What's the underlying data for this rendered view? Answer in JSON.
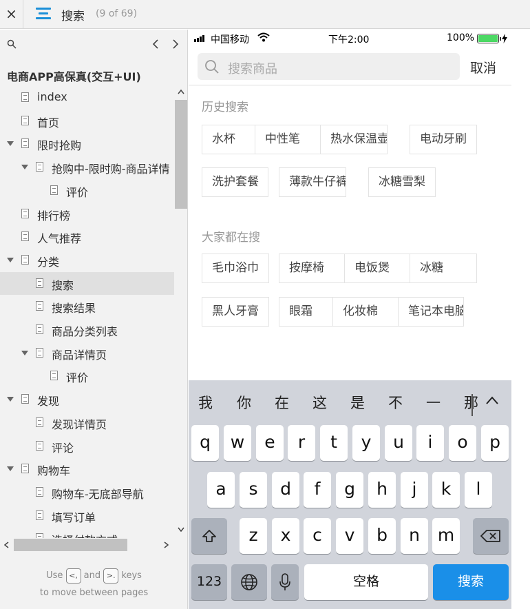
{
  "topbar": {
    "close_glyph": "×",
    "title": "搜索",
    "count": "(9 of 69)",
    "menu_icon": "hamburger-menu-icon"
  },
  "sidebar": {
    "project_title": "电商APP高保真(交互+UI)",
    "tree": [
      {
        "label": "index",
        "level": 0,
        "expandable": false,
        "selected": false
      },
      {
        "label": "首页",
        "level": 0,
        "expandable": false,
        "selected": false
      },
      {
        "label": "限时抢购",
        "level": 0,
        "expandable": true,
        "selected": false
      },
      {
        "label": "抢购中-限时购-商品详情",
        "level": 1,
        "expandable": true,
        "selected": false
      },
      {
        "label": "评价",
        "level": 2,
        "expandable": false,
        "selected": false
      },
      {
        "label": "排行榜",
        "level": 0,
        "expandable": false,
        "selected": false
      },
      {
        "label": "人气推荐",
        "level": 0,
        "expandable": false,
        "selected": false
      },
      {
        "label": "分类",
        "level": 0,
        "expandable": true,
        "selected": false
      },
      {
        "label": "搜索",
        "level": 1,
        "expandable": false,
        "selected": true
      },
      {
        "label": "搜索结果",
        "level": 1,
        "expandable": false,
        "selected": false
      },
      {
        "label": "商品分类列表",
        "level": 1,
        "expandable": false,
        "selected": false
      },
      {
        "label": "商品详情页",
        "level": 1,
        "expandable": true,
        "selected": false
      },
      {
        "label": "评价",
        "level": 2,
        "expandable": false,
        "selected": false
      },
      {
        "label": "发现",
        "level": 0,
        "expandable": true,
        "selected": false
      },
      {
        "label": "发现详情页",
        "level": 1,
        "expandable": false,
        "selected": false
      },
      {
        "label": "评论",
        "level": 1,
        "expandable": false,
        "selected": false
      },
      {
        "label": "购物车",
        "level": 0,
        "expandable": true,
        "selected": false
      },
      {
        "label": "购物车-无底部导航",
        "level": 1,
        "expandable": false,
        "selected": false
      },
      {
        "label": "填写订单",
        "level": 1,
        "expandable": false,
        "selected": false
      },
      {
        "label": "选择付款方式",
        "level": 1,
        "expandable": false,
        "selected": false
      }
    ],
    "hint": {
      "use": "Use",
      "key_prev": "<,",
      "and": "and",
      "key_next": ">.",
      "keys": "keys",
      "line2": "to move between pages"
    }
  },
  "phone": {
    "status": {
      "carrier": "中国移动",
      "time": "下午2:00",
      "battery_pct": "100%",
      "battery_level": 1.0
    },
    "search_placeholder": "搜索商品",
    "cancel_label": "取消",
    "history_title": "历史搜索",
    "history_tags": [
      "水杯",
      "中性笔",
      "热水保温壶",
      "电动牙刷",
      "洗护套餐",
      "薄款牛仔裤",
      "冰糖雪梨"
    ],
    "popular_title": "大家都在搜",
    "popular_tags": [
      "毛巾浴巾",
      "按摩椅",
      "电饭煲",
      "冰糖",
      "黑人牙膏",
      "眼霜",
      "化妆棉",
      "笔记本电脑"
    ]
  },
  "keyboard": {
    "candidates": [
      "我",
      "你",
      "在",
      "这",
      "是",
      "不",
      "一",
      "那"
    ],
    "row1": [
      "q",
      "w",
      "e",
      "r",
      "t",
      "y",
      "u",
      "i",
      "o",
      "p"
    ],
    "row2": [
      "a",
      "s",
      "d",
      "f",
      "g",
      "h",
      "j",
      "k",
      "l"
    ],
    "row3": [
      "z",
      "x",
      "c",
      "v",
      "b",
      "n",
      "m"
    ],
    "num_label": "123",
    "space_label": "空格",
    "search_label": "搜索"
  },
  "colors": {
    "accent": "#1a8fd8",
    "keyboard_bg": "#d1d4db",
    "search_key": "#1a8fe8",
    "battery": "#4cd964"
  }
}
